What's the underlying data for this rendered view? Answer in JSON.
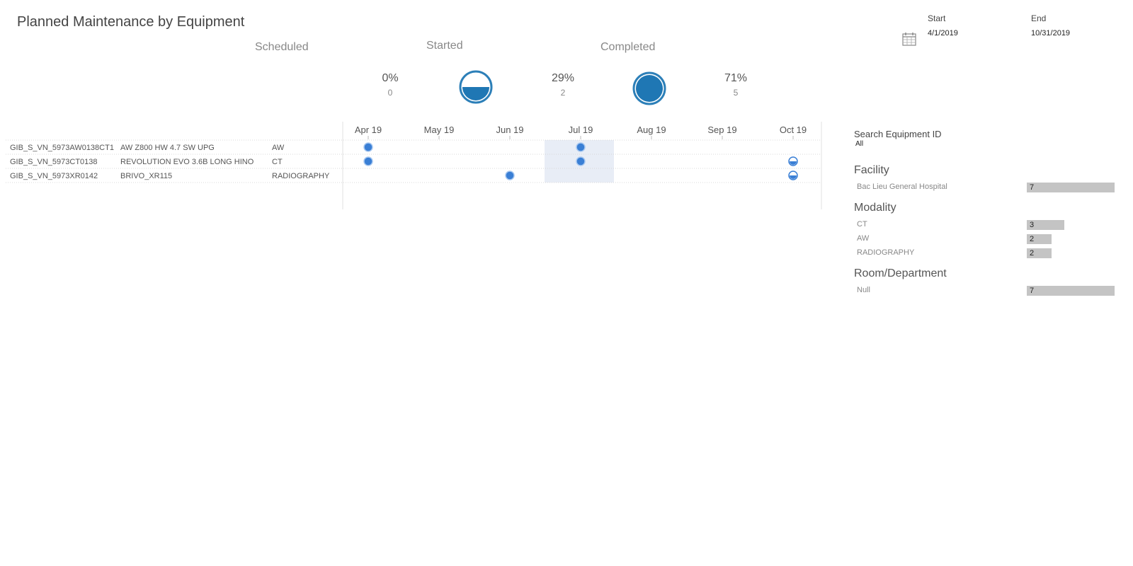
{
  "title": "Planned Maintenance by Equipment",
  "status": {
    "scheduled": {
      "label": "Scheduled",
      "pct": "0%",
      "count": "0"
    },
    "started": {
      "label": "Started",
      "pct": "29%",
      "count": "2"
    },
    "completed": {
      "label": "Completed",
      "pct": "71%",
      "count": "5"
    }
  },
  "date_range": {
    "start_label": "Start",
    "start_value": "4/1/2019",
    "end_label": "End",
    "end_value": "10/31/2019"
  },
  "colors": {
    "marker_fill": "#3a7fd5",
    "ring_stroke": "#2c7fb8",
    "ring_fill": "#1f77b4",
    "highlight": "#e8edf6",
    "filter_bar": "#c4c4c4"
  },
  "timeline": {
    "months": [
      "Apr 19",
      "May 19",
      "Jun 19",
      "Jul 19",
      "Aug 19",
      "Sep 19",
      "Oct 19"
    ],
    "highlight_month": 3,
    "rows": [
      {
        "id": "GIB_S_VN_5973AW0138CT1",
        "name": "AW Z800 HW 4.7 SW UPG",
        "modality": "AW",
        "events": [
          {
            "month": 0,
            "status": "completed"
          },
          {
            "month": 3,
            "status": "completed"
          }
        ]
      },
      {
        "id": "GIB_S_VN_5973CT0138",
        "name": "REVOLUTION EVO 3.6B LONG HINO",
        "modality": "CT",
        "events": [
          {
            "month": 0,
            "status": "completed"
          },
          {
            "month": 3,
            "status": "completed"
          },
          {
            "month": 6,
            "status": "started"
          }
        ]
      },
      {
        "id": "GIB_S_VN_5973XR0142",
        "name": "BRIVO_XR115",
        "modality": "RADIOGRAPHY",
        "events": [
          {
            "month": 2,
            "status": "completed"
          },
          {
            "month": 6,
            "status": "started"
          }
        ]
      }
    ]
  },
  "filters": {
    "search_label": "Search Equipment ID",
    "search_value": "All",
    "facility": {
      "heading": "Facility",
      "items": [
        {
          "label": "Bac Lieu General Hospital",
          "count": 7
        }
      ]
    },
    "modality": {
      "heading": "Modality",
      "items": [
        {
          "label": "CT",
          "count": 3
        },
        {
          "label": "AW",
          "count": 2
        },
        {
          "label": "RADIOGRAPHY",
          "count": 2
        }
      ]
    },
    "room": {
      "heading": "Room/Department",
      "items": [
        {
          "label": "Null",
          "count": 7
        }
      ]
    }
  }
}
